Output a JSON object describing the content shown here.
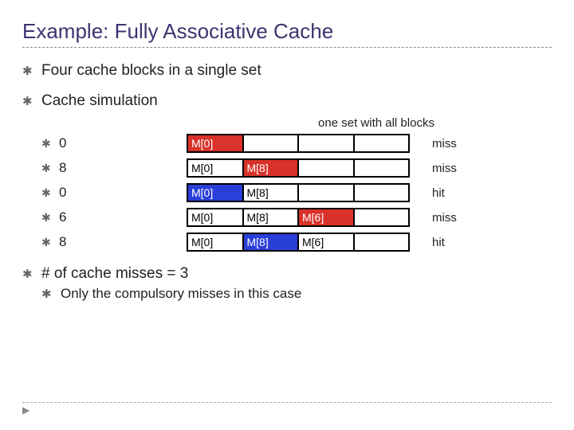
{
  "title": "Example: Fully Associative Cache",
  "bullets": {
    "four_blocks": "Four cache blocks in a single set",
    "cache_sim": "Cache simulation",
    "misses": "# of cache misses = 3",
    "compulsory": "Only the compulsory misses in this case"
  },
  "caption": "one set with all blocks",
  "rows": [
    {
      "addr": "0",
      "cells": [
        {
          "t": "M[0]",
          "c": "r"
        },
        {
          "t": "",
          "c": ""
        },
        {
          "t": "",
          "c": ""
        },
        {
          "t": "",
          "c": ""
        }
      ],
      "result": "miss"
    },
    {
      "addr": "8",
      "cells": [
        {
          "t": "M[0]",
          "c": ""
        },
        {
          "t": "M[8]",
          "c": "r"
        },
        {
          "t": "",
          "c": ""
        },
        {
          "t": "",
          "c": ""
        }
      ],
      "result": "miss"
    },
    {
      "addr": "0",
      "cells": [
        {
          "t": "M[0]",
          "c": "b"
        },
        {
          "t": "M[8]",
          "c": ""
        },
        {
          "t": "",
          "c": ""
        },
        {
          "t": "",
          "c": ""
        }
      ],
      "result": "hit"
    },
    {
      "addr": "6",
      "cells": [
        {
          "t": "M[0]",
          "c": ""
        },
        {
          "t": "M[8]",
          "c": ""
        },
        {
          "t": "M[6]",
          "c": "r"
        },
        {
          "t": "",
          "c": ""
        }
      ],
      "result": "miss"
    },
    {
      "addr": "8",
      "cells": [
        {
          "t": "M[0]",
          "c": ""
        },
        {
          "t": "M[8]",
          "c": "b"
        },
        {
          "t": "M[6]",
          "c": ""
        },
        {
          "t": "",
          "c": ""
        }
      ],
      "result": "hit"
    }
  ]
}
